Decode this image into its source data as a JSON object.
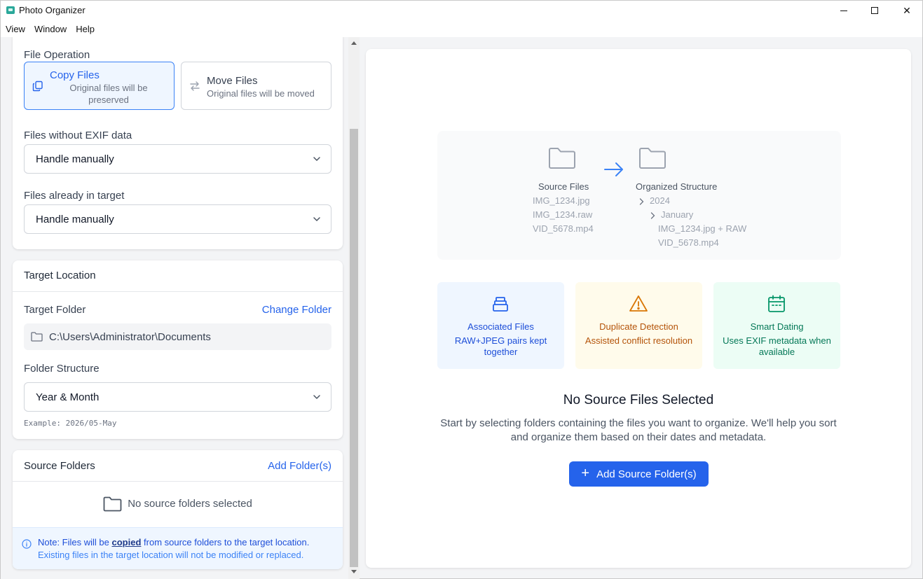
{
  "window": {
    "title": "Photo Organizer",
    "controls": {
      "minimize": "minimize",
      "maximize": "maximize",
      "close": "✕"
    }
  },
  "menu": [
    "View",
    "Window",
    "Help"
  ],
  "file_operation": {
    "label": "File Operation",
    "copy": {
      "title": "Copy Files",
      "subtitle": "Original files will be preserved",
      "selected": true
    },
    "move": {
      "title": "Move Files",
      "subtitle": "Original files will be moved",
      "selected": false
    }
  },
  "exif": {
    "label": "Files without EXIF data",
    "value": "Handle manually"
  },
  "existing": {
    "label": "Files already in target",
    "value": "Handle manually"
  },
  "target": {
    "title": "Target Location",
    "folder_label": "Target Folder",
    "change_link": "Change Folder",
    "path": "C:\\Users\\Administrator\\Documents",
    "structure_label": "Folder Structure",
    "structure_value": "Year & Month",
    "example": "Example: 2026/05-May"
  },
  "source": {
    "title": "Source Folders",
    "add_link": "Add Folder(s)",
    "empty": "No source folders selected",
    "note_prefix": "Note: Files will be",
    "note_bold": "copied",
    "note_suffix": "from source folders to the target location.",
    "note_line2": "Existing files in the target location will not be modified or replaced."
  },
  "diagram": {
    "source_label": "Source Files",
    "source_files": [
      "IMG_1234.jpg",
      "IMG_1234.raw",
      "VID_5678.mp4"
    ],
    "target_label": "Organized Structure",
    "year": "2024",
    "month": "January",
    "target_files": [
      "IMG_1234.jpg + RAW",
      "VID_5678.mp4"
    ]
  },
  "features": [
    {
      "title": "Associated Files",
      "desc": "RAW+JPEG pairs kept together",
      "icon": "stack-icon",
      "color": "#1d4ed8"
    },
    {
      "title": "Duplicate Detection",
      "desc": "Assisted conflict resolution",
      "icon": "warning-icon",
      "color": "#b45309"
    },
    {
      "title": "Smart Dating",
      "desc": "Uses EXIF metadata when available",
      "icon": "calendar-icon",
      "color": "#047857"
    }
  ],
  "empty_state": {
    "title": "No Source Files Selected",
    "desc": "Start by selecting folders containing the files you want to organize. We'll help you sort and organize them based on their dates and metadata.",
    "button": "Add Source Folder(s)"
  },
  "colors": {
    "accent": "#2563eb"
  }
}
